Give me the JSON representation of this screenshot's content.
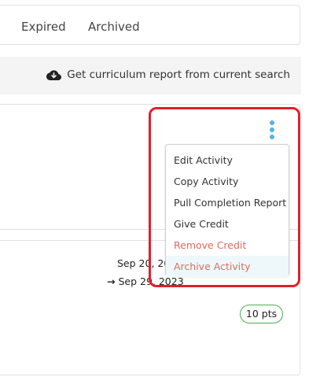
{
  "tabs": [
    {
      "label": "Expired"
    },
    {
      "label": "Archived"
    }
  ],
  "report_bar": {
    "icon": "cloud-download-icon",
    "label": "Get curriculum report from current search"
  },
  "activity": {
    "menu_icon": "vertical-ellipsis-icon",
    "start_date": "Sep 20, 20",
    "end_date": "Sep 29, 2023",
    "points_badge": "10 pts"
  },
  "context_menu": {
    "items": [
      {
        "label": "Edit Activity"
      },
      {
        "label": "Copy Activity"
      },
      {
        "label": "Pull Completion Report"
      },
      {
        "label": "Give Credit"
      },
      {
        "label": "Remove Credit"
      },
      {
        "label": "Archive Activity"
      }
    ]
  },
  "colors": {
    "accent": "#4fb3e8",
    "danger": "#e06b5f",
    "highlight": "#e0202a",
    "badge_border": "#4caf50",
    "hover_bg": "#eef8fb"
  }
}
